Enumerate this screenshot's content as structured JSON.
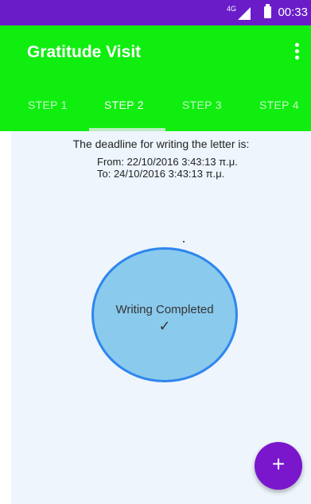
{
  "status_bar": {
    "network": "4G",
    "time": "00:33"
  },
  "app_bar": {
    "title": "Gratitude Visit"
  },
  "tabs": [
    {
      "label": "STEP 1"
    },
    {
      "label": "STEP 2",
      "selected": true
    },
    {
      "label": "STEP 3"
    },
    {
      "label": "STEP 4"
    }
  ],
  "content": {
    "deadline_text": "The deadline for writing the letter is:",
    "from_line": "From: 22/10/2016 3:43:13 π.μ.",
    "to_line": "To:   24/10/2016 3:43:13 π.μ.",
    "status_circle": {
      "label": "Writing Completed",
      "check": "✓"
    }
  },
  "fab": {
    "label": "+"
  },
  "colors": {
    "status_bar": "#6a1cc9",
    "app_bar": "#10ee10",
    "background": "#eef5fd",
    "circle_fill": "#8acaec",
    "circle_border": "#2f86ee",
    "fab": "#7a16cc"
  }
}
